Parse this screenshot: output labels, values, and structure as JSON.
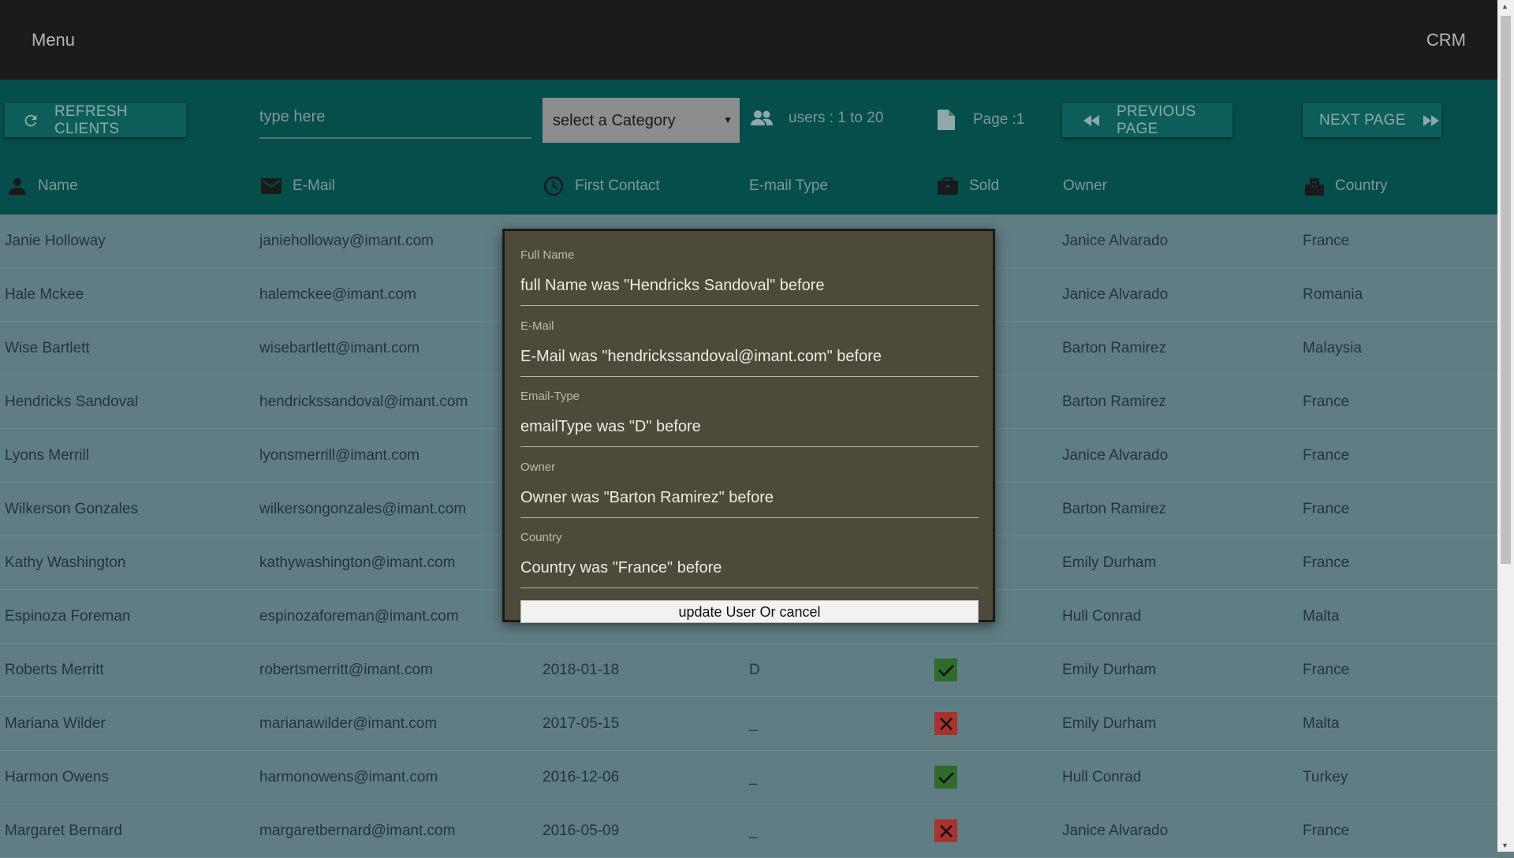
{
  "app": {
    "menu_label": "Menu",
    "title": "CRM"
  },
  "toolbar": {
    "refresh_label": "REFRESH CLIENTS",
    "search_placeholder": "type here",
    "category_placeholder": "select a Category",
    "users_range": "users : 1 to 20",
    "page_label": "Page :1",
    "previous_label": "PREVIOUS PAGE",
    "next_label": "NEXT PAGE"
  },
  "columns": {
    "name": "Name",
    "email": "E-Mail",
    "first_contact": "First Contact",
    "email_type": "E-mail Type",
    "sold": "Sold",
    "owner": "Owner",
    "country": "Country"
  },
  "rows": [
    {
      "name": "Janie Holloway",
      "email": "janieholloway@imant.com",
      "first_contact": "",
      "email_type": "",
      "sold": false,
      "owner": "Janice Alvarado",
      "country": "France"
    },
    {
      "name": "Hale Mckee",
      "email": "halemckee@imant.com",
      "first_contact": "",
      "email_type": "",
      "sold": false,
      "owner": "Janice Alvarado",
      "country": "Romania"
    },
    {
      "name": "Wise Bartlett",
      "email": "wisebartlett@imant.com",
      "first_contact": "",
      "email_type": "",
      "sold": false,
      "owner": "Barton Ramirez",
      "country": "Malaysia"
    },
    {
      "name": "Hendricks Sandoval",
      "email": "hendrickssandoval@imant.com",
      "first_contact": "",
      "email_type": "",
      "sold": true,
      "owner": "Barton Ramirez",
      "country": "France"
    },
    {
      "name": "Lyons Merrill",
      "email": "lyonsmerrill@imant.com",
      "first_contact": "",
      "email_type": "",
      "sold": null,
      "owner": "Janice Alvarado",
      "country": "France"
    },
    {
      "name": "Wilkerson Gonzales",
      "email": "wilkersongonzales@imant.com",
      "first_contact": "",
      "email_type": "",
      "sold": false,
      "owner": "Barton Ramirez",
      "country": "France"
    },
    {
      "name": "Kathy Washington",
      "email": "kathywashington@imant.com",
      "first_contact": "",
      "email_type": "",
      "sold": true,
      "owner": "Emily Durham",
      "country": "France"
    },
    {
      "name": "Espinoza Foreman",
      "email": "espinozaforeman@imant.com",
      "first_contact": "",
      "email_type": "",
      "sold": false,
      "owner": "Hull Conrad",
      "country": "Malta"
    },
    {
      "name": "Roberts Merritt",
      "email": "robertsmerritt@imant.com",
      "first_contact": "2018-01-18",
      "email_type": "D",
      "sold": true,
      "owner": "Emily Durham",
      "country": "France"
    },
    {
      "name": "Mariana Wilder",
      "email": "marianawilder@imant.com",
      "first_contact": "2017-05-15",
      "email_type": "_",
      "sold": false,
      "owner": "Emily Durham",
      "country": "Malta"
    },
    {
      "name": "Harmon Owens",
      "email": "harmonowens@imant.com",
      "first_contact": "2016-12-06",
      "email_type": "_",
      "sold": true,
      "owner": "Hull Conrad",
      "country": "Turkey"
    },
    {
      "name": "Margaret Bernard",
      "email": "margaretbernard@imant.com",
      "first_contact": "2016-05-09",
      "email_type": "_",
      "sold": false,
      "owner": "Janice Alvarado",
      "country": "France"
    }
  ],
  "modal": {
    "full_name_label": "Full Name",
    "full_name_value": "full Name was \"Hendricks Sandoval\" before",
    "email_label": "E-Mail",
    "email_value": "E-Mail was \"hendrickssandoval@imant.com\" before",
    "email_type_label": "Email-Type",
    "email_type_value": "emailType was \"D\" before",
    "owner_label": "Owner",
    "owner_value": "Owner was \"Barton Ramirez\" before",
    "country_label": "Country",
    "country_value": "Country was \"France\" before",
    "submit_label": "update User Or cancel"
  },
  "colors": {
    "appbar": "#1b1b1b",
    "toolbar": "#054e4c",
    "table_bg": "#607d84",
    "sold_yes": "#2e6b2c",
    "sold_no": "#a8322d",
    "modal_bg": "#4e4a3b"
  },
  "icons": {
    "refresh": "refresh-icon",
    "users": "users-icon",
    "page": "file-icon",
    "previous": "rewind-icon",
    "next": "fast-forward-icon",
    "name": "person-icon",
    "email": "envelope-icon",
    "first_contact": "clock-icon",
    "sold": "briefcase-icon",
    "country": "building-icon"
  }
}
